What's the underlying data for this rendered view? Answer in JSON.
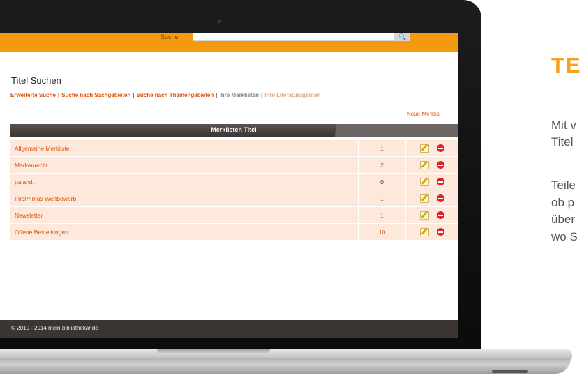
{
  "header": {
    "search_label": "Suche",
    "search_value": "",
    "search_button": "🔍"
  },
  "page_title": "Titel Suchen",
  "subnav": [
    {
      "label": "Erweiterte Suche",
      "state": "link"
    },
    {
      "label": "Suche nach Sachgebieten",
      "state": "link"
    },
    {
      "label": "Suche nach Themengebieten",
      "state": "link"
    },
    {
      "label": "Ihre Merklisten",
      "state": "current"
    },
    {
      "label": "Ihre Literaturagenten",
      "state": "link"
    }
  ],
  "separator": "|",
  "new_list_link": "Neue Merklis",
  "table": {
    "header": "Merklisten Titel",
    "rows": [
      {
        "name": "Allgemeine Merkliste",
        "count": "1"
      },
      {
        "name": "Markenrecht",
        "count": "2"
      },
      {
        "name": "palandt",
        "count": "0"
      },
      {
        "name": "InfoPrimus Wettbewerb",
        "count": "1"
      },
      {
        "name": "Newsletter",
        "count": "1"
      },
      {
        "name": "Offene Bestellungen",
        "count": "10"
      }
    ]
  },
  "footer": "© 2010 - 2014 mein-bibliothekar.de",
  "side": {
    "heading": "TE",
    "lines1": [
      "Mit v",
      "Titel"
    ],
    "lines2": [
      "Teile",
      "ob p",
      "über",
      "wo S"
    ]
  },
  "colors": {
    "accent": "#f49a10",
    "link": "#e0520e",
    "row_bg": "#fde9dc",
    "dark": "#3b3534",
    "heading": "#f5a31a"
  },
  "icons": {
    "edit": "pencil-edit-icon",
    "delete": "red-minus-delete-icon",
    "search": "magnifier-icon"
  }
}
